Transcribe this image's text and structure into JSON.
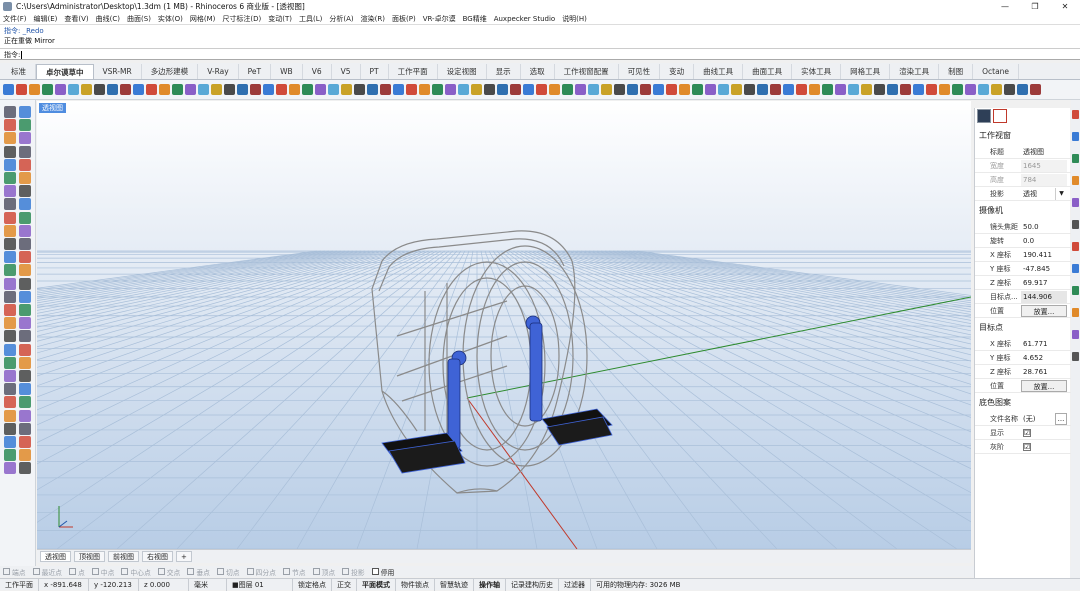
{
  "window": {
    "title": "C:\\Users\\Administrator\\Desktop\\1.3dm (1 MB) - Rhinoceros 6 商业版 - [透视图]",
    "controls": [
      "—",
      "❐",
      "✕"
    ]
  },
  "menu": [
    "文件(F)",
    "编辑(E)",
    "查看(V)",
    "曲线(C)",
    "曲面(S)",
    "实体(O)",
    "网格(M)",
    "尺寸标注(D)",
    "变动(T)",
    "工具(L)",
    "分析(A)",
    "渲染(R)",
    "面板(P)",
    "VR-卓尔谟",
    "BG精维",
    "Auxpecker Studio",
    "说明(H)"
  ],
  "command": {
    "history": [
      "指令: _Redo",
      "正在重做 Mirror"
    ],
    "prompt": "指令:"
  },
  "toolbar_tabs": [
    "标准",
    "卓尔谟草中",
    "VSR-MR",
    "多边形建模",
    "V-Ray",
    "PeT",
    "WB",
    "V6",
    "V5",
    "PT",
    "工作平面",
    "设定视图",
    "显示",
    "选取",
    "工作视窗配置",
    "可见性",
    "变动",
    "曲线工具",
    "曲面工具",
    "实体工具",
    "网格工具",
    "渲染工具",
    "制图",
    "Octane"
  ],
  "active_toolbar_tab": "卓尔谟草中",
  "viewport": {
    "label": "透视图",
    "tabs": [
      "透视图",
      "顶视图",
      "前视图",
      "右视图",
      "+"
    ],
    "active_tab": "透视图"
  },
  "osnap": {
    "items": [
      "端点",
      "最近点",
      "点",
      "中点",
      "中心点",
      "交点",
      "垂点",
      "切点",
      "四分点",
      "节点",
      "顶点",
      "投影",
      "停用"
    ],
    "checked": [
      "停用"
    ]
  },
  "status": {
    "cplane": "工作平面",
    "x": "x -891.648",
    "y": "y -120.213",
    "z": "z 0.000",
    "units": "毫米",
    "layer": "■图层 01",
    "toggles": [
      "锁定格点",
      "正交",
      "平面模式",
      "物件锁点",
      "智慧轨迹",
      "操作轴",
      "记录建构历史",
      "过滤器"
    ],
    "bold_toggles": [
      "平面模式",
      "操作轴"
    ],
    "memory": "可用的物理内存: 3026 MB"
  },
  "panel": {
    "section_viewport": "工作视窗",
    "rows_viewport": [
      {
        "label": "标题",
        "value": "透视图",
        "disabled": false
      },
      {
        "label": "宽度",
        "value": "1645",
        "disabled": true
      },
      {
        "label": "高度",
        "value": "784",
        "disabled": true
      },
      {
        "label": "投影",
        "value": "透视",
        "disabled": false
      }
    ],
    "section_camera": "摄像机",
    "rows_camera": [
      {
        "label": "镜头焦距",
        "value": "50.0"
      },
      {
        "label": "旋转",
        "value": "0.0"
      },
      {
        "label": "X 座标",
        "value": "190.411"
      },
      {
        "label": "Y 座标",
        "value": "-47.845"
      },
      {
        "label": "Z 座标",
        "value": "69.917"
      },
      {
        "label": "目标点...",
        "value": "144.906"
      }
    ],
    "camera_position_label": "位置",
    "place_button": "放置...",
    "section_target": "目标点",
    "rows_target": [
      {
        "label": "X 座标",
        "value": "61.771"
      },
      {
        "label": "Y 座标",
        "value": "4.652"
      },
      {
        "label": "Z 座标",
        "value": "28.761"
      }
    ],
    "target_position_label": "位置",
    "section_wallpaper": "底色图案",
    "wallpaper_filename_label": "文件名称",
    "wallpaper_filename_value": "(无)",
    "wallpaper_more": "...",
    "show_label": "显示",
    "gray_label": "灰阶",
    "check_mark": "☑"
  },
  "colors": {
    "accent": "#4f8de0",
    "model_wire": "#8a8a8a",
    "crank_blue": "#3f63d6",
    "pedal_black": "#111111",
    "axis_x": "#c0392b",
    "axis_y": "#2e8b2e",
    "grid": "#a9bfd9"
  }
}
